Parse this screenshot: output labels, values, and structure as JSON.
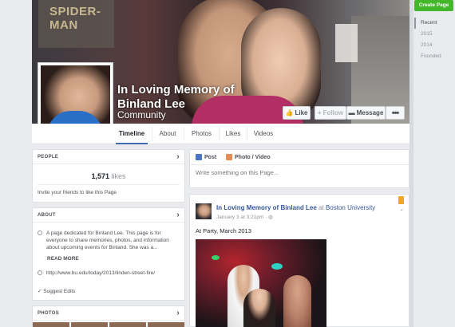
{
  "cover": {
    "page_name": "In Loving Memory of Binland Lee",
    "category": "Community"
  },
  "actions": {
    "like_label": "Like",
    "follow_label": "Follow",
    "message_label": "Message",
    "more_label": "•••"
  },
  "nav": {
    "tabs": [
      {
        "label": "Timeline",
        "active": true
      },
      {
        "label": "About"
      },
      {
        "label": "Photos"
      },
      {
        "label": "Likes"
      },
      {
        "label": "Videos"
      }
    ]
  },
  "people": {
    "header": "PEOPLE",
    "likes_count": "1,571",
    "likes_word": "likes",
    "invite_text": "Invite your friends to like this Page"
  },
  "about": {
    "header": "ABOUT",
    "description": "A page dedicated for Binland Lee. This page is for everyone to share memories, photos, and information about upcoming events for Binland. She was a...",
    "read_more": "READ MORE",
    "link": "http://www.bu.edu/today/2013/linden-street-fire/",
    "suggest_edits": "Suggest Edits"
  },
  "photos": {
    "header": "PHOTOS"
  },
  "composer": {
    "post_tab": "Post",
    "photo_video_tab": "Photo / Video",
    "placeholder": "Write something on this Page..."
  },
  "post": {
    "author": "In Loving Memory of Binland Lee",
    "at_word": "at",
    "location": "Boston University",
    "timestamp": "January 3 at 3:21pm",
    "text": "At Party, March 2013"
  },
  "sidebar": {
    "create_page": "Create Page",
    "timeline_items": [
      {
        "label": "Recent",
        "active": true
      },
      {
        "label": "2015"
      },
      {
        "label": "2014"
      },
      {
        "label": "Founded"
      }
    ]
  },
  "cover_art": {
    "poster_text": "SPIDER-MAN"
  }
}
